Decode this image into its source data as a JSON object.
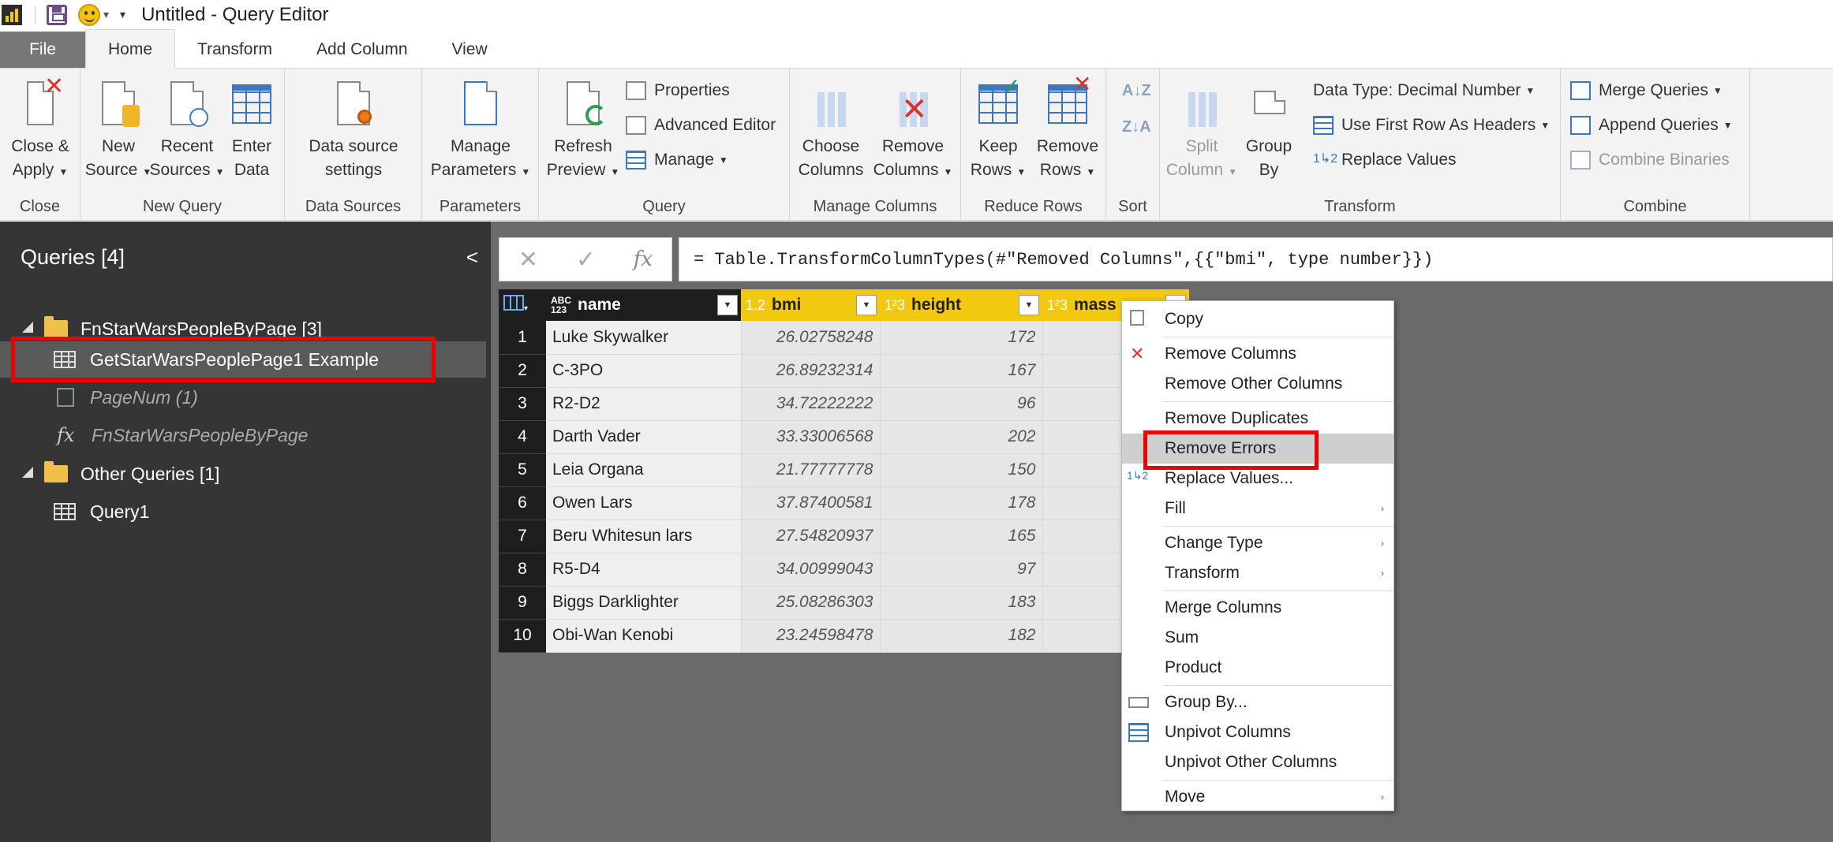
{
  "titlebar": {
    "title": "Untitled - Query Editor"
  },
  "tabs": [
    {
      "label": "File"
    },
    {
      "label": "Home"
    },
    {
      "label": "Transform"
    },
    {
      "label": "Add Column"
    },
    {
      "label": "View"
    }
  ],
  "ribbon": {
    "close": {
      "button": [
        "Close &",
        "Apply"
      ],
      "group": "Close"
    },
    "new_query": {
      "new_source": [
        "New",
        "Source"
      ],
      "recent_sources": [
        "Recent",
        "Sources"
      ],
      "enter_data": [
        "Enter",
        "Data"
      ],
      "group": "New Query"
    },
    "data_sources": {
      "settings": [
        "Data source",
        "settings"
      ],
      "group": "Data Sources"
    },
    "parameters": {
      "manage": [
        "Manage",
        "Parameters"
      ],
      "group": "Parameters"
    },
    "query": {
      "refresh": [
        "Refresh",
        "Preview"
      ],
      "properties": "Properties",
      "advanced_editor": "Advanced Editor",
      "manage": "Manage",
      "group": "Query"
    },
    "manage_columns": {
      "choose": [
        "Choose",
        "Columns"
      ],
      "remove": [
        "Remove",
        "Columns"
      ],
      "group": "Manage Columns"
    },
    "reduce_rows": {
      "keep": [
        "Keep",
        "Rows"
      ],
      "remove": [
        "Remove",
        "Rows"
      ],
      "group": "Reduce Rows"
    },
    "sort": {
      "group": "Sort"
    },
    "transform": {
      "split": [
        "Split",
        "Column"
      ],
      "group_by": [
        "Group",
        "By"
      ],
      "data_type": "Data Type: Decimal Number",
      "first_row": "Use First Row As Headers",
      "replace": "Replace Values",
      "group": "Transform"
    },
    "combine": {
      "merge": "Merge Queries",
      "append": "Append Queries",
      "binaries": "Combine Binaries",
      "group": "Combine"
    }
  },
  "sidebar": {
    "header": "Queries [4]",
    "items": [
      {
        "label": "FnStarWarsPeopleByPage [3]"
      },
      {
        "label": "GetStarWarsPeoplePage1 Example"
      },
      {
        "label": "PageNum (1)"
      },
      {
        "label": "FnStarWarsPeopleByPage"
      },
      {
        "label": "Other Queries [1]"
      },
      {
        "label": "Query1"
      }
    ]
  },
  "formula": {
    "cancel": "✕",
    "commit": "✓",
    "fx": "fx",
    "text": "= Table.TransformColumnTypes(#\"Removed Columns\",{{\"bmi\", type number}})"
  },
  "table": {
    "columns": [
      {
        "type_top": "ABC",
        "type_bottom": "123",
        "name": "name"
      },
      {
        "type": "1.2",
        "name": "bmi"
      },
      {
        "type": "1²3",
        "name": "height"
      },
      {
        "type": "1²3",
        "name": "mass"
      }
    ],
    "rows": [
      {
        "n": "1",
        "name": "Luke Skywalker",
        "bmi": "26.02758248",
        "height": "172"
      },
      {
        "n": "2",
        "name": "C-3PO",
        "bmi": "26.89232314",
        "height": "167"
      },
      {
        "n": "3",
        "name": "R2-D2",
        "bmi": "34.72222222",
        "height": "96"
      },
      {
        "n": "4",
        "name": "Darth Vader",
        "bmi": "33.33006568",
        "height": "202"
      },
      {
        "n": "5",
        "name": "Leia Organa",
        "bmi": "21.77777778",
        "height": "150"
      },
      {
        "n": "6",
        "name": "Owen Lars",
        "bmi": "37.87400581",
        "height": "178"
      },
      {
        "n": "7",
        "name": "Beru Whitesun lars",
        "bmi": "27.54820937",
        "height": "165"
      },
      {
        "n": "8",
        "name": "R5-D4",
        "bmi": "34.00999043",
        "height": "97"
      },
      {
        "n": "9",
        "name": "Biggs Darklighter",
        "bmi": "25.08286303",
        "height": "183"
      },
      {
        "n": "10",
        "name": "Obi-Wan Kenobi",
        "bmi": "23.24598478",
        "height": "182"
      }
    ]
  },
  "menu": [
    {
      "label": "Copy"
    },
    {
      "label": "Remove Columns"
    },
    {
      "label": "Remove Other Columns"
    },
    {
      "label": "Remove Duplicates"
    },
    {
      "label": "Remove Errors"
    },
    {
      "label": "Replace Values..."
    },
    {
      "label": "Fill"
    },
    {
      "label": "Change Type"
    },
    {
      "label": "Transform"
    },
    {
      "label": "Merge Columns"
    },
    {
      "label": "Sum"
    },
    {
      "label": "Product"
    },
    {
      "label": "Group By..."
    },
    {
      "label": "Unpivot Columns"
    },
    {
      "label": "Unpivot Other Columns"
    },
    {
      "label": "Move"
    }
  ]
}
